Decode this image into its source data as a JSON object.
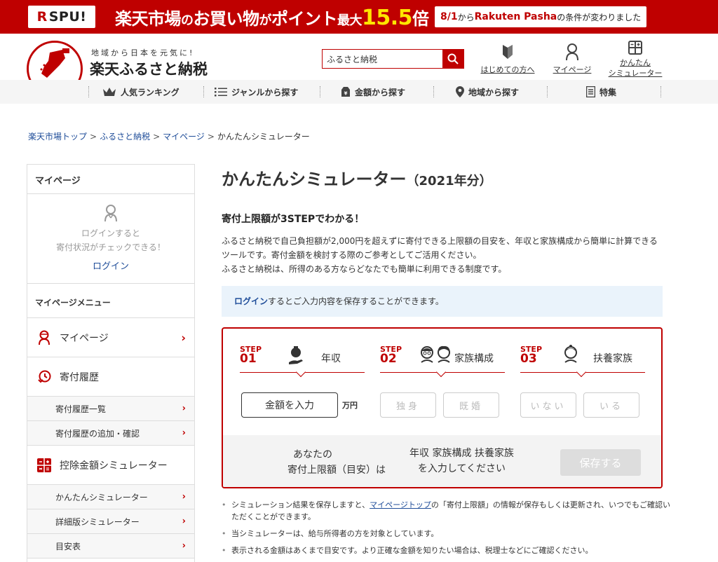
{
  "banner": {
    "spu_brand": "SPU",
    "spu_r": "R",
    "spu_excl": "!",
    "main_prefix": "楽天市場",
    "main_no": "の",
    "main_mid": "お買い物",
    "main_ga": "が",
    "main_point": "ポイント",
    "main_max": "最大",
    "main_num": "15.5",
    "main_bai": "倍",
    "note_date": "8/1",
    "note_kara": "から",
    "note_service": "Rakuten Pasha",
    "note_rest": "の条件が変わりました"
  },
  "header": {
    "tagline": "地域から日本を元気に!",
    "site_name": "楽天ふるさと納税",
    "search": {
      "value": "ふるさと納税"
    },
    "nav": [
      {
        "label": "はじめての方へ"
      },
      {
        "label": "マイページ"
      },
      {
        "label1": "かんたん",
        "label2": "シミュレーター"
      }
    ]
  },
  "navbar": {
    "ranking": "人気ランキング",
    "genre": "ジャンルから探す",
    "price": "金額から探す",
    "region": "地域から探す",
    "feature": "特集"
  },
  "breadcrumb": {
    "items": [
      "楽天市場トップ",
      "ふるさと納税",
      "マイページ",
      "かんたんシミュレーター"
    ],
    "sep": ">"
  },
  "sidebar": {
    "title": "マイページ",
    "login_msg1": "ログインすると",
    "login_msg2": "寄付状況がチェックできる！",
    "login_link": "ログイン",
    "menu_title": "マイページメニュー",
    "mypage": "マイページ",
    "history": "寄付履歴",
    "history_list": "寄付履歴一覧",
    "history_add": "寄付履歴の追加・確認",
    "deduction": "控除金額シミュレーター",
    "simple_sim": "かんたんシミュレーター",
    "detail_sim": "詳細版シミュレーター",
    "guide_table": "目安表"
  },
  "main": {
    "title": "かんたんシミュレーター",
    "year": "（2021年分）",
    "subhead": "寄付上限額が3STEPでわかる！",
    "desc1": "ふるさと納税で自己負担額が2,000円を超えずに寄付できる上限額の目安を、年収と家族構成から簡単に計算できるツールです。寄付金額を検討する際のご参考としてご活用ください。",
    "desc2": "ふるさと納税は、所得のある方ならどなたでも簡単に利用できる制度です。",
    "info_link": "ログイン",
    "info_rest": "するとご入力内容を保存することができます。"
  },
  "simulator": {
    "steps": [
      {
        "step": "STEP",
        "num": "01",
        "label": "年収"
      },
      {
        "step": "STEP",
        "num": "02",
        "label": "家族構成"
      },
      {
        "step": "STEP",
        "num": "03",
        "label": "扶養家族"
      }
    ],
    "amount_button": "金額を入力",
    "unit": "万円",
    "single": "独身",
    "married": "既婚",
    "none": "いない",
    "exists": "いる",
    "result_label1": "あなたの",
    "result_label2": "寄付上限額（目安）は",
    "hint1": "年収 家族構成 扶養家族",
    "hint2": "を入力してください",
    "save": "保存する"
  },
  "notes": {
    "n1_pre": "シミュレーション結果を保存しますと、",
    "n1_link": "マイページトップ",
    "n1_post": "の「寄付上限額」の情報が保存もしくは更新され、いつでもご確認いただくことができます。",
    "n2": "当シミュレーターは、給与所得者の方を対象としています。",
    "n3": "表示される金額はあくまで目安です。より正確な金額を知りたい場合は、税理士などにご確認ください。"
  },
  "colors": {
    "brand_red": "#bf0000",
    "highlight_yellow": "#ffe600",
    "link_blue": "#1f4d99",
    "info_bg": "#eaf3fb"
  }
}
